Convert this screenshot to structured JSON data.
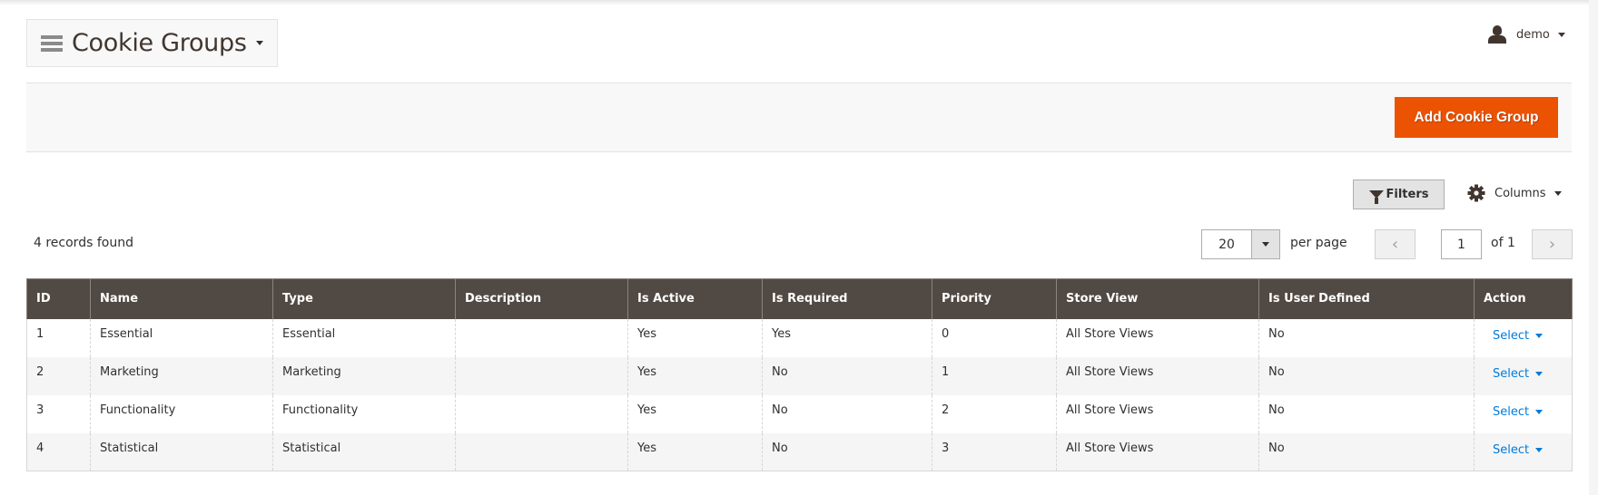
{
  "header": {
    "title": "Cookie Groups",
    "user": {
      "name": "demo",
      "icon": "user-icon"
    }
  },
  "actions": {
    "add_label": "Add Cookie Group",
    "add_color": "#eb5202"
  },
  "toolbar": {
    "filters_label": "Filters",
    "columns_label": "Columns",
    "records_found": "4 records found",
    "per_page_value": "20",
    "per_page_label": "per page",
    "prev_label": "‹",
    "next_label": "›",
    "current_page": "1",
    "page_total": "of 1"
  },
  "grid": {
    "columns": [
      "ID",
      "Name",
      "Type",
      "Description",
      "Is Active",
      "Is Required",
      "Priority",
      "Store View",
      "Is User Defined",
      "Action"
    ],
    "rows": [
      {
        "id": "1",
        "name": "Essential",
        "type": "Essential",
        "description": "",
        "is_active": "Yes",
        "is_required": "Yes",
        "priority": "0",
        "store_view": "All Store Views",
        "is_user_defined": "No",
        "action": "Select"
      },
      {
        "id": "2",
        "name": "Marketing",
        "type": "Marketing",
        "description": "",
        "is_active": "Yes",
        "is_required": "No",
        "priority": "1",
        "store_view": "All Store Views",
        "is_user_defined": "No",
        "action": "Select"
      },
      {
        "id": "3",
        "name": "Functionality",
        "type": "Functionality",
        "description": "",
        "is_active": "Yes",
        "is_required": "No",
        "priority": "2",
        "store_view": "All Store Views",
        "is_user_defined": "No",
        "action": "Select"
      },
      {
        "id": "4",
        "name": "Statistical",
        "type": "Statistical",
        "description": "",
        "is_active": "Yes",
        "is_required": "No",
        "priority": "3",
        "store_view": "All Store Views",
        "is_user_defined": "No",
        "action": "Select"
      }
    ],
    "header_color": "#514943",
    "link_color": "#007bdb"
  }
}
